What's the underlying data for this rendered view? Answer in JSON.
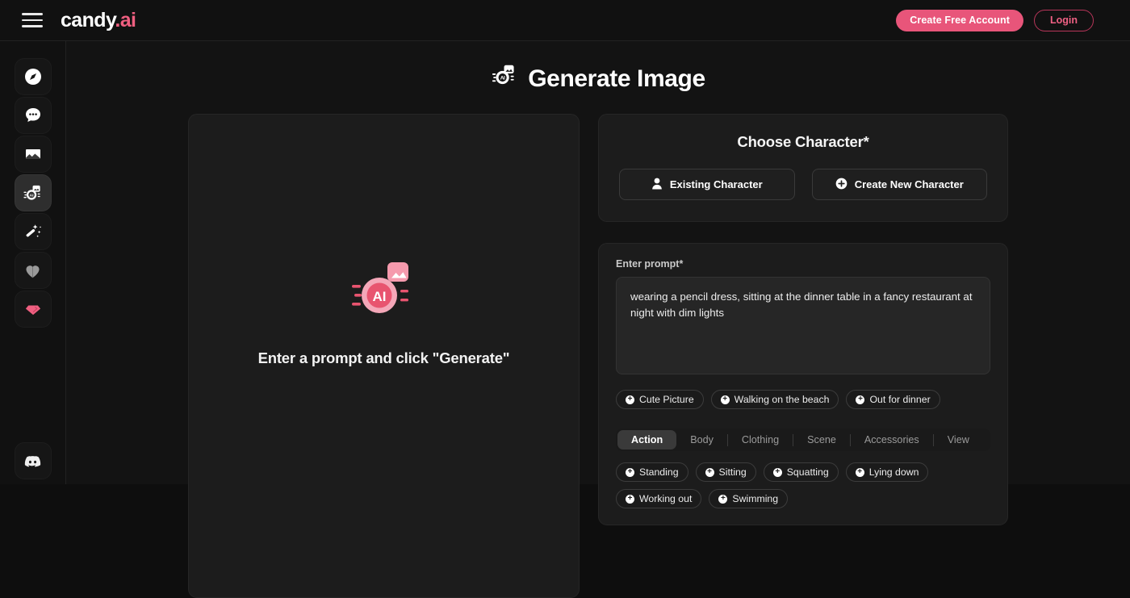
{
  "header": {
    "menu_icon": "hamburger-icon",
    "logo_main": "candy",
    "logo_suffix": ".ai",
    "create_account_label": "Create Free Account",
    "login_label": "Login",
    "accent_color": "#e8557a"
  },
  "sidebar": {
    "items": [
      {
        "icon": "compass-icon",
        "name": "explore",
        "active": false
      },
      {
        "icon": "chat-bubble-icon",
        "name": "chat",
        "active": false
      },
      {
        "icon": "image-gallery-icon",
        "name": "gallery",
        "active": false
      },
      {
        "icon": "ai-camera-icon",
        "name": "generate-image",
        "active": true
      },
      {
        "icon": "magic-wand-icon",
        "name": "magic-tools",
        "active": false
      },
      {
        "icon": "heart-icon",
        "name": "favorites",
        "active": false
      },
      {
        "icon": "diamond-icon",
        "name": "premium",
        "active": false
      }
    ],
    "bottom": {
      "icon": "discord-icon",
      "name": "discord"
    }
  },
  "main": {
    "title": "Generate Image",
    "title_icon": "ai-camera-icon"
  },
  "preview": {
    "icon": "ai-image-placeholder-icon",
    "message": "Enter a prompt and click \"Generate\""
  },
  "character": {
    "title": "Choose Character*",
    "existing_label": "Existing Character",
    "existing_icon": "person-icon",
    "create_label": "Create New Character",
    "create_icon": "plus-circle-icon"
  },
  "prompt": {
    "label": "Enter prompt*",
    "value": "wearing a pencil dress, sitting at the dinner table in a fancy restaurant at night with dim lights",
    "placeholder": "Enter prompt",
    "suggestions": [
      "Cute Picture",
      "Walking on the beach",
      "Out for dinner"
    ]
  },
  "tabs": {
    "items": [
      {
        "label": "Action",
        "active": true
      },
      {
        "label": "Body",
        "active": false
      },
      {
        "label": "Clothing",
        "active": false
      },
      {
        "label": "Scene",
        "active": false
      },
      {
        "label": "Accessories",
        "active": false
      },
      {
        "label": "View",
        "active": false
      }
    ]
  },
  "action_options": [
    "Standing",
    "Sitting",
    "Squatting",
    "Lying down",
    "Working out",
    "Swimming"
  ]
}
